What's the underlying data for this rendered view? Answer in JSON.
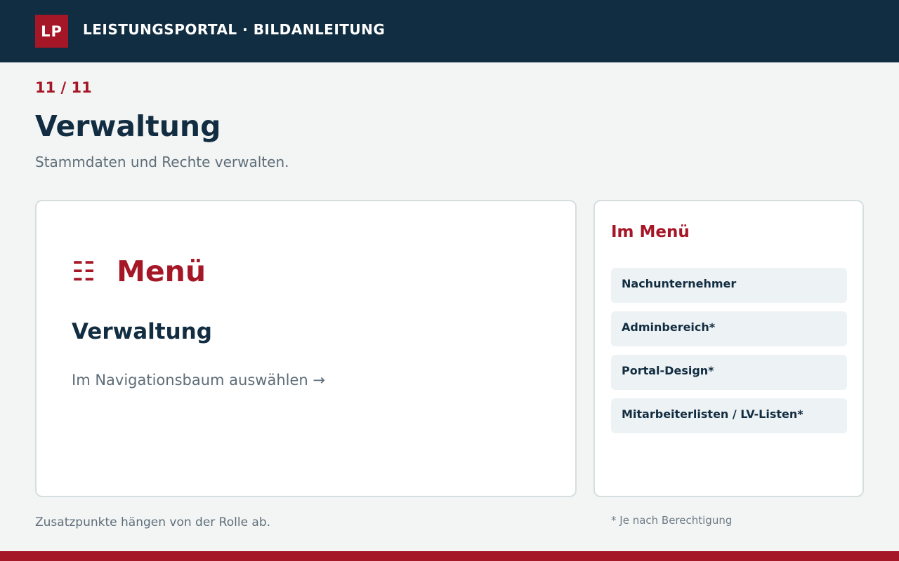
{
  "header": {
    "logo_text": "LP",
    "title": "LEISTUNGSPORTAL · BILDANLEITUNG"
  },
  "step": "11 / 11",
  "page": {
    "title": "Verwaltung",
    "subtitle": "Stammdaten und Rechte verwalten."
  },
  "main_card": {
    "menu_icon": "☷",
    "menu_icon_name": "menu-grid-icon",
    "menu_label": "Menü",
    "section_title": "Verwaltung",
    "hint": "Im Navigationsbaum auswählen →"
  },
  "side_card": {
    "heading": "Im Menü",
    "items": [
      {
        "label": "Nachunternehmer"
      },
      {
        "label": "Adminbereich*"
      },
      {
        "label": "Portal-Design*"
      },
      {
        "label": "Mitarbeiterlisten / LV-Listen*"
      }
    ]
  },
  "footer": {
    "note_left": "Zusatzpunkte hängen von der Rolle ab.",
    "note_right": "* Je nach Berechtigung"
  },
  "colors": {
    "header_bg": "#112d41",
    "accent": "#a51626",
    "page_bg": "#f3f5f5",
    "item_bg": "#edf2f4"
  }
}
